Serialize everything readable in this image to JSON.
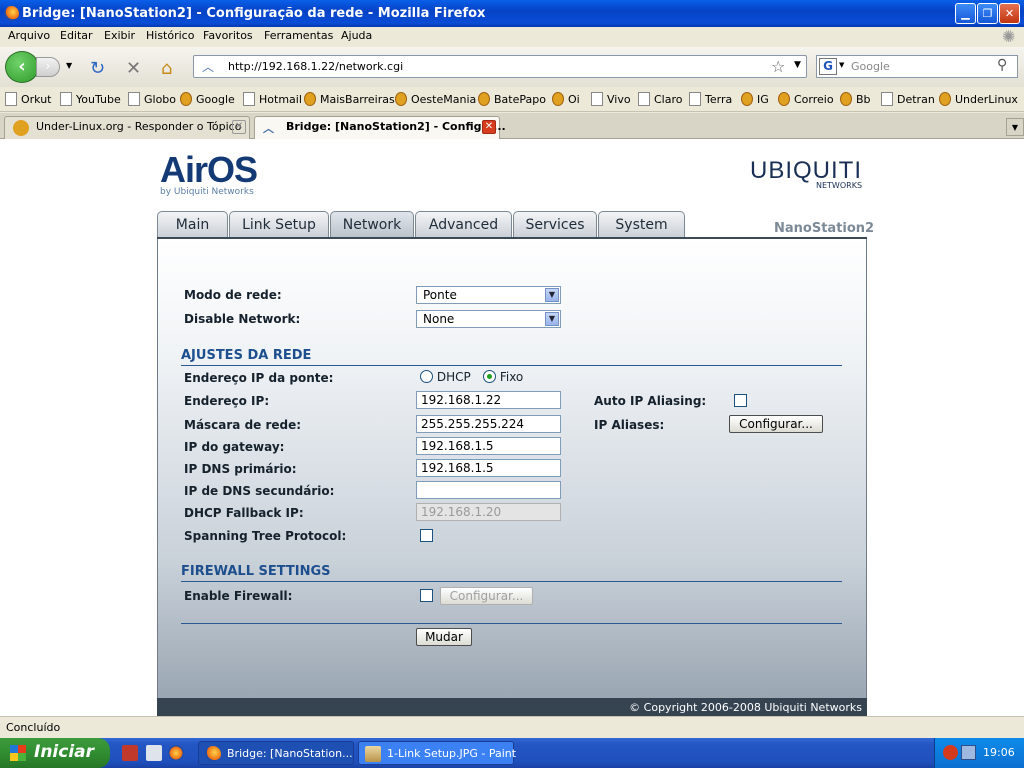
{
  "window": {
    "title": "Bridge: [NanoStation2] - Configuração da rede - Mozilla Firefox"
  },
  "menu": [
    "Arquivo",
    "Editar",
    "Exibir",
    "Histórico",
    "Favoritos",
    "Ferramentas",
    "Ajuda"
  ],
  "nav": {
    "url": "http://192.168.1.22/network.cgi",
    "search_placeholder": "Google",
    "search_engine_icon": "G"
  },
  "bookmarks": [
    "Orkut",
    "YouTube",
    "Globo",
    "Google",
    "Hotmail",
    "MaisBarreiras",
    "OesteMania",
    "BatePapo",
    "Oi",
    "Vivo",
    "Claro",
    "Terra",
    "IG",
    "Correio",
    "Bb",
    "Detran",
    "UnderLinux"
  ],
  "tabs": [
    {
      "label": "Under-Linux.org - Responder o Tópico"
    },
    {
      "label": "Bridge: [NanoStation2] - Configur..."
    }
  ],
  "page": {
    "logo_text": "AirOS",
    "logo_sub": "by Ubiquiti Networks",
    "brand": "UBIQUITI",
    "brand_sub": "NETWORKS",
    "device_name": "NanoStation2",
    "main_tabs": [
      "Main",
      "Link Setup",
      "Network",
      "Advanced",
      "Services",
      "System"
    ],
    "active_tab": "Network",
    "fields": {
      "network_mode_label": "Modo de rede:",
      "network_mode_value": "Ponte",
      "disable_network_label": "Disable Network:",
      "disable_network_value": "None",
      "section_network": "AJUSTES DA REDE",
      "bridge_ip_label": "Endereço IP da ponte:",
      "dhcp_label": "DHCP",
      "fixed_label": "Fixo",
      "ip_label": "Endereço IP:",
      "ip_value": "192.168.1.22",
      "netmask_label": "Máscara de rede:",
      "netmask_value": "255.255.255.224",
      "gateway_label": "IP do gateway:",
      "gateway_value": "192.168.1.5",
      "dns1_label": "IP DNS primário:",
      "dns1_value": "192.168.1.5",
      "dns2_label": "IP de DNS secundário:",
      "dns2_value": "",
      "fallback_label": "DHCP Fallback IP:",
      "fallback_value": "192.168.1.20",
      "stp_label": "Spanning Tree Protocol:",
      "auto_alias_label": "Auto IP Aliasing:",
      "aliases_label": "IP Aliases:",
      "aliases_button": "Configurar...",
      "section_firewall": "FIREWALL SETTINGS",
      "firewall_label": "Enable Firewall:",
      "firewall_button": "Configurar...",
      "submit_button": "Mudar"
    },
    "footer": "© Copyright 2006-2008 Ubiquiti Networks"
  },
  "status": "Concluído",
  "taskbar": {
    "start": "Iniciar",
    "windows": [
      "Bridge: [NanoStation...",
      "1-Link Setup.JPG - Paint"
    ],
    "clock": "19:06"
  }
}
